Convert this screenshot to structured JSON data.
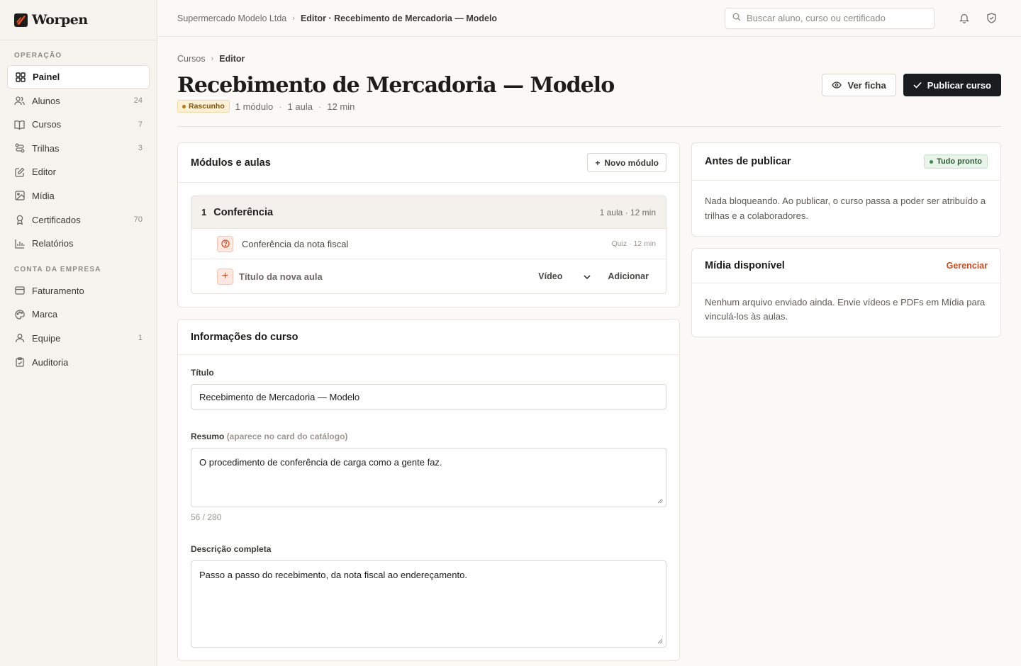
{
  "brand": {
    "name": "Worpen",
    "accent": "#e4531e"
  },
  "sidebar": {
    "section_ops": "OPERAÇÃO",
    "ops_items": [
      {
        "label": "Painel",
        "count": "",
        "icon": "grid-icon"
      },
      {
        "label": "Alunos",
        "count": "24",
        "icon": "users-icon"
      },
      {
        "label": "Cursos",
        "count": "7",
        "icon": "book-icon"
      },
      {
        "label": "Trilhas",
        "count": "3",
        "icon": "route-icon"
      },
      {
        "label": "Editor",
        "count": "",
        "icon": "edit-icon"
      },
      {
        "label": "Mídia",
        "count": "",
        "icon": "image-icon"
      },
      {
        "label": "Certificados",
        "count": "70",
        "icon": "award-icon"
      },
      {
        "label": "Relatórios",
        "count": "",
        "icon": "chart-icon"
      }
    ],
    "section_company": "CONTA DA EMPRESA",
    "company_items": [
      {
        "label": "Faturamento",
        "count": "",
        "icon": "card-icon"
      },
      {
        "label": "Marca",
        "count": "",
        "icon": "palette-icon"
      },
      {
        "label": "Equipe",
        "count": "1",
        "icon": "user-icon"
      },
      {
        "label": "Auditoria",
        "count": "",
        "icon": "clipboard-icon"
      }
    ]
  },
  "topbar": {
    "crumb_company": "Supermercado Modelo Ltda",
    "crumb_current": "Editor · Recebimento de Mercadoria — Modelo",
    "search_placeholder": "Buscar aluno, curso ou certificado"
  },
  "page": {
    "crumb_parent": "Cursos",
    "crumb_current": "Editor",
    "title": "Recebimento de Mercadoria — Modelo",
    "status": "Rascunho",
    "meta_modules": "1 módulo",
    "meta_lessons": "1 aula",
    "meta_duration": "12 min",
    "btn_view": "Ver ficha",
    "btn_publish": "Publicar curso"
  },
  "modules_card": {
    "title": "Módulos e aulas",
    "new_module": "Novo módulo",
    "module": {
      "number": "1",
      "name": "Conferência",
      "meta": "1 aula · 12 min",
      "lessons": [
        {
          "name": "Conferência da nota fiscal",
          "meta": "Quiz · 12 min"
        }
      ]
    },
    "new_lesson_placeholder": "Título da nova aula",
    "lesson_type": "Vídeo",
    "add_label": "Adicionar"
  },
  "info_card": {
    "title": "Informações do curso",
    "title_label": "Título",
    "title_value": "Recebimento de Mercadoria — Modelo",
    "summary_label": "Resumo",
    "summary_hint": "(aparece no card do catálogo)",
    "summary_value": "O procedimento de conferência de carga como a gente faz.",
    "summary_counter": "56 / 280",
    "description_label": "Descrição completa",
    "description_value": "Passo a passo do recebimento, da nota fiscal ao endereçamento."
  },
  "publish_card": {
    "title": "Antes de publicar",
    "badge": "Tudo pronto",
    "body": "Nada bloqueando. Ao publicar, o curso passa a poder ser atribuído a trilhas e a colaboradores."
  },
  "media_card": {
    "title": "Mídia disponível",
    "manage": "Gerenciar",
    "body": "Nenhum arquivo enviado ainda. Envie vídeos e PDFs em Mídia para vinculá-los às aulas."
  }
}
